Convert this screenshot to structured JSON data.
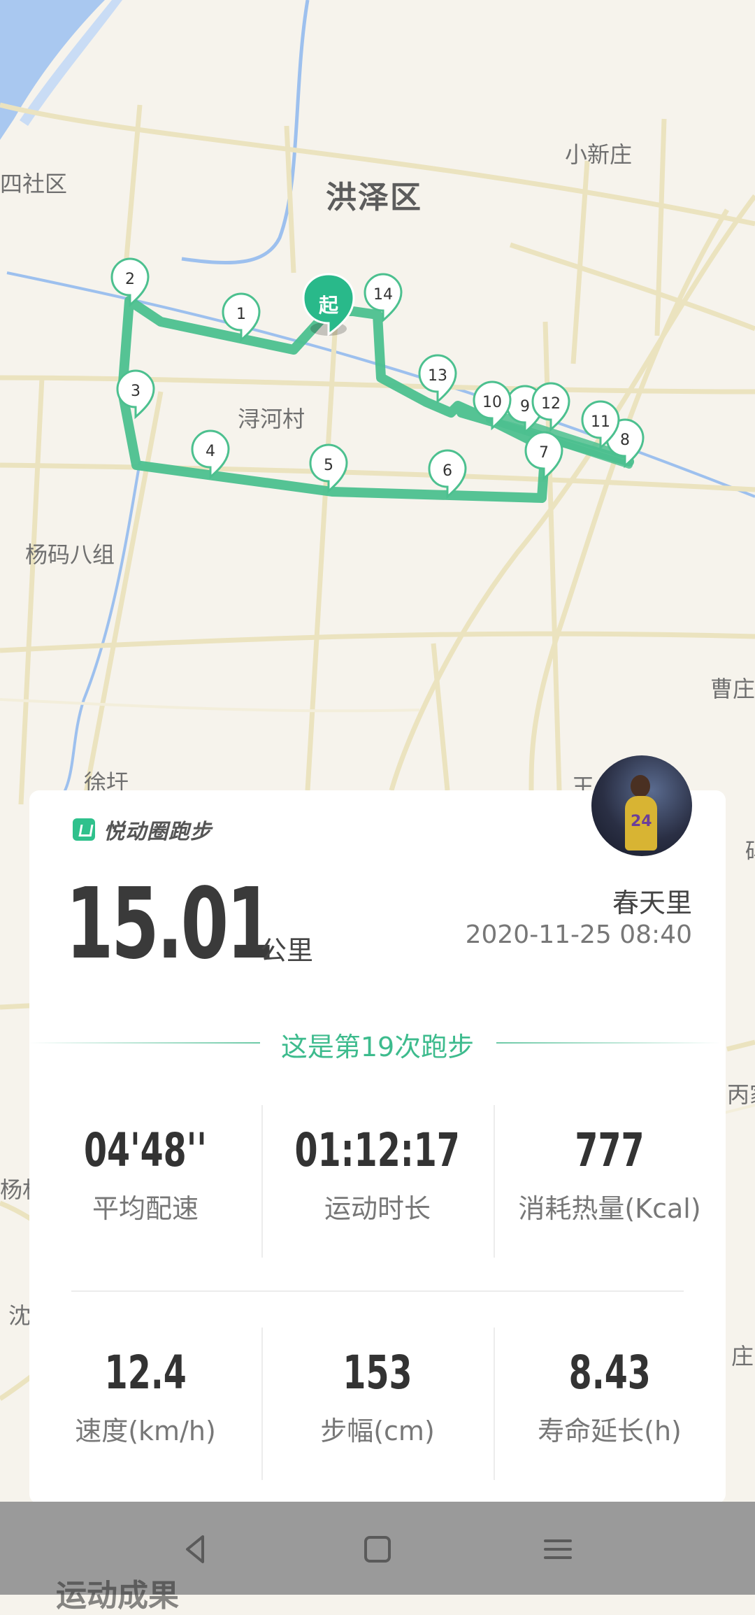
{
  "map": {
    "labels": {
      "district": "洪泽区",
      "xiaoxinzhuang": "小新庄",
      "sishequ": "四社区",
      "xunhecun": "浔河村",
      "yangma": "杨码八组",
      "caozhuang": "曹庄",
      "xuwei": "徐圩",
      "wang": "王",
      "mu": "码",
      "huanjia": "丙家",
      "yangcun": "杨村",
      "shen": "沈",
      "zhuang": "庄"
    },
    "route_color": "#4cc08f",
    "markers": [
      "1",
      "2",
      "3",
      "4",
      "5",
      "6",
      "7",
      "8",
      "9",
      "10",
      "11",
      "12",
      "13",
      "14"
    ],
    "start_label": "起"
  },
  "card": {
    "brand": "悦动圈跑步",
    "distance": "15.01",
    "distance_unit": "公里",
    "username": "春天里",
    "datetime": "2020-11-25 08:40",
    "run_count": "这是第19次跑步",
    "stats": [
      {
        "value": "04'48''",
        "label": "平均配速"
      },
      {
        "value": "01:12:17",
        "label": "运动时长"
      },
      {
        "value": "777",
        "label": "消耗热量(Kcal)"
      },
      {
        "value": "12.4",
        "label": "速度(km/h)"
      },
      {
        "value": "153",
        "label": "步幅(cm)"
      },
      {
        "value": "8.43",
        "label": "寿命延长(h)"
      }
    ]
  },
  "navbar": {
    "hidden_title": "运动成果"
  }
}
